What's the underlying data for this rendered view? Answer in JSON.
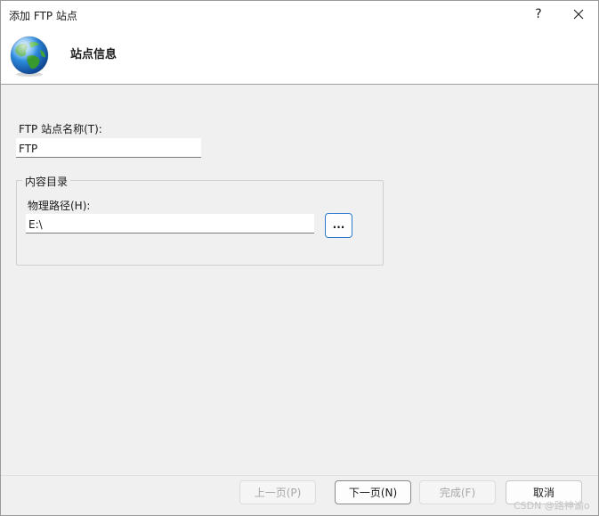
{
  "window": {
    "title": "添加 FTP 站点",
    "help_label": "?"
  },
  "header": {
    "title": "站点信息",
    "icon": "globe-icon"
  },
  "form": {
    "site_name_label": "FTP 站点名称(T):",
    "site_name_value": "FTP",
    "content_group_label": "内容目录",
    "physical_path_label": "物理路径(H):",
    "physical_path_value": "E:\\",
    "browse_label": "..."
  },
  "footer": {
    "prev_label": "上一页(P)",
    "next_label": "下一页(N)",
    "finish_label": "完成(F)",
    "cancel_label": "取消"
  },
  "watermark": "CSDN @路神谕o",
  "colors": {
    "accent": "#2a7bd0",
    "dialog_bg": "#f0f0f0",
    "header_bg": "#ffffff"
  }
}
